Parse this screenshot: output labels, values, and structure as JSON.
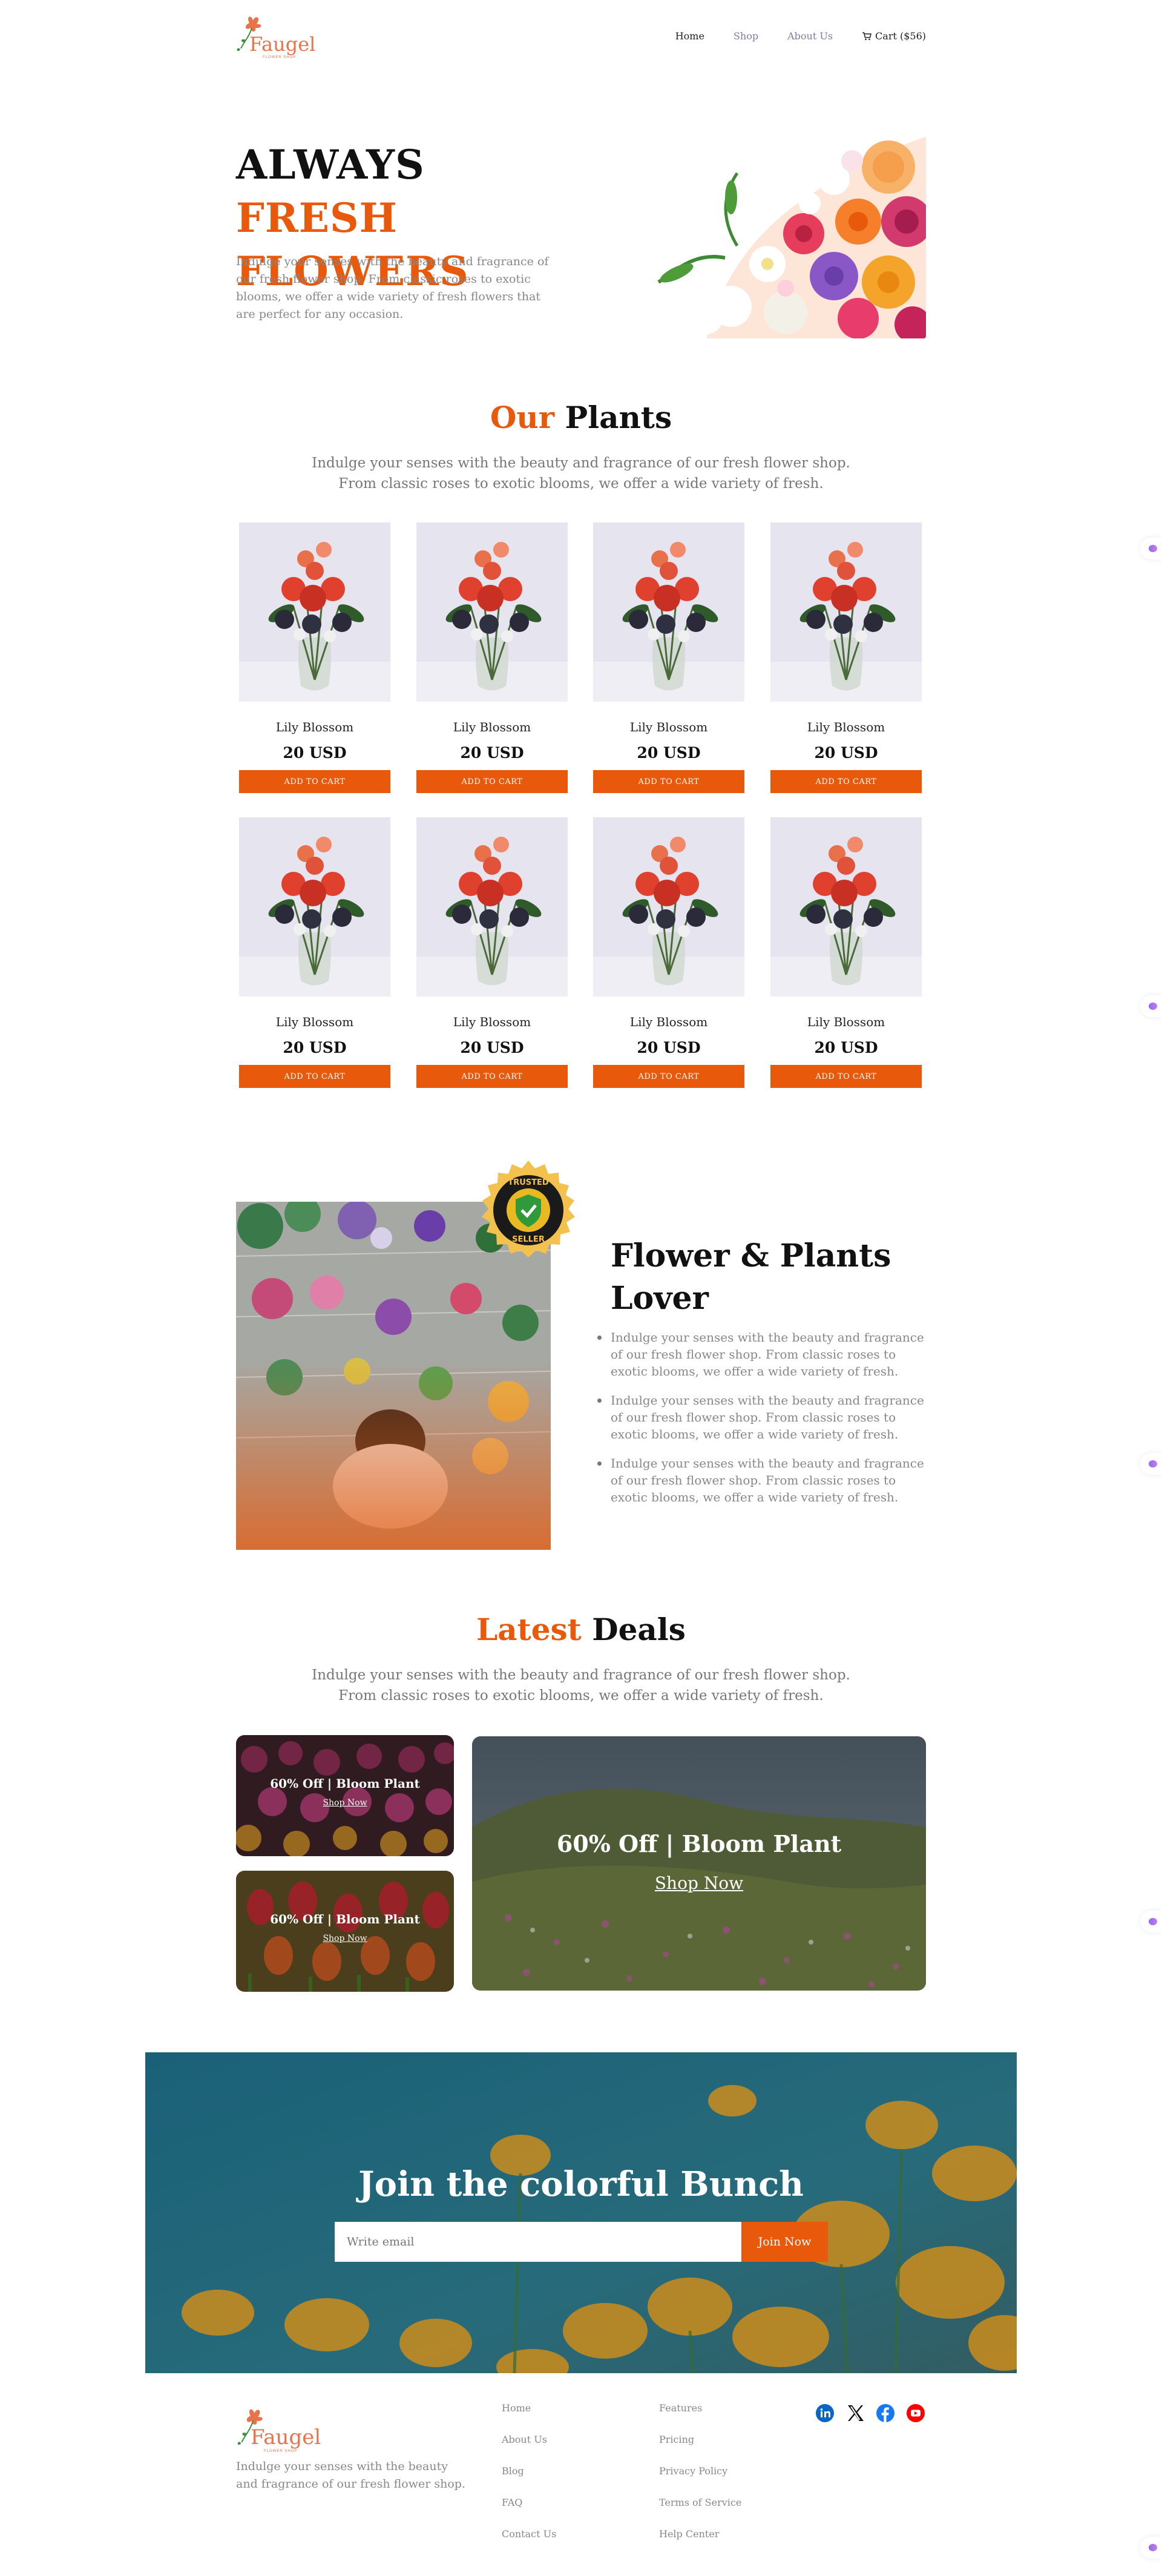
{
  "header": {
    "logo_text": "Faugel",
    "logo_tagline": "FLOWER SHOP",
    "nav": [
      "Home",
      "Shop",
      "About Us"
    ],
    "cart_label": "Cart ($56)"
  },
  "hero": {
    "title_black": "ALWAYS",
    "title_orange_1": "FRESH",
    "title_orange_2": "FLOWERS",
    "description": "Indulge your senses with the beauty and fragrance of our fresh flower shop. From classic roses to exotic blooms, we offer a wide variety of fresh flowers that are perfect for any occasion."
  },
  "plants": {
    "title_orange": "Our",
    "title_black": "Plants",
    "subtitle": "Indulge your senses with the beauty and fragrance of our fresh flower shop. From classic roses to exotic blooms, we offer a wide variety of fresh.",
    "products": [
      {
        "name": "Lily Blossom",
        "price": "20 USD",
        "button": "ADD TO CART"
      },
      {
        "name": "Lily Blossom",
        "price": "20 USD",
        "button": "ADD TO CART"
      },
      {
        "name": "Lily Blossom",
        "price": "20 USD",
        "button": "ADD TO CART"
      },
      {
        "name": "Lily Blossom",
        "price": "20 USD",
        "button": "ADD TO CART"
      },
      {
        "name": "Lily Blossom",
        "price": "20 USD",
        "button": "ADD TO CART"
      },
      {
        "name": "Lily Blossom",
        "price": "20 USD",
        "button": "ADD TO CART"
      },
      {
        "name": "Lily Blossom",
        "price": "20 USD",
        "button": "ADD TO CART"
      },
      {
        "name": "Lily Blossom",
        "price": "20 USD",
        "button": "ADD TO CART"
      }
    ]
  },
  "lover": {
    "badge_top": "TRUSTED",
    "badge_bottom": "SELLER",
    "title": "Flower & Plants Lover",
    "bullets": [
      "Indulge your senses with the beauty and fragrance of our fresh flower shop. From classic roses to exotic blooms, we offer a wide variety of fresh.",
      "Indulge your senses with the beauty and fragrance of our fresh flower shop. From classic roses to exotic blooms, we offer a wide variety of fresh.",
      "Indulge your senses with the beauty and fragrance of our fresh flower shop. From classic roses to exotic blooms, we offer a wide variety of fresh."
    ]
  },
  "deals": {
    "title_orange": "Latest",
    "title_black": "Deals",
    "subtitle": "Indulge your senses with the beauty and fragrance of our fresh flower shop. From classic roses to exotic blooms, we offer a wide variety of fresh.",
    "items": [
      {
        "title": "60% Off | Bloom Plant",
        "link": "Shop Now"
      },
      {
        "title": "60% Off | Bloom Plant",
        "link": "Shop Now"
      },
      {
        "title": "60% Off | Bloom Plant",
        "link": "Shop Now"
      }
    ]
  },
  "newsletter": {
    "title": "Join the colorful Bunch",
    "placeholder": "Write email",
    "button": "Join Now"
  },
  "footer": {
    "description": "Indulge your senses with the beauty and fragrance of our fresh flower shop.",
    "col1": [
      "Home",
      "About Us",
      "Blog",
      "FAQ",
      "Contact Us"
    ],
    "col2": [
      "Features",
      "Pricing",
      "Privacy Policy",
      "Terms of Service",
      "Help Center"
    ],
    "social": [
      "linkedin-icon",
      "x-icon",
      "facebook-icon",
      "youtube-icon"
    ]
  },
  "colors": {
    "accent": "#e8590c",
    "nav_muted": "#7b7ba8",
    "text_muted": "#888888"
  }
}
